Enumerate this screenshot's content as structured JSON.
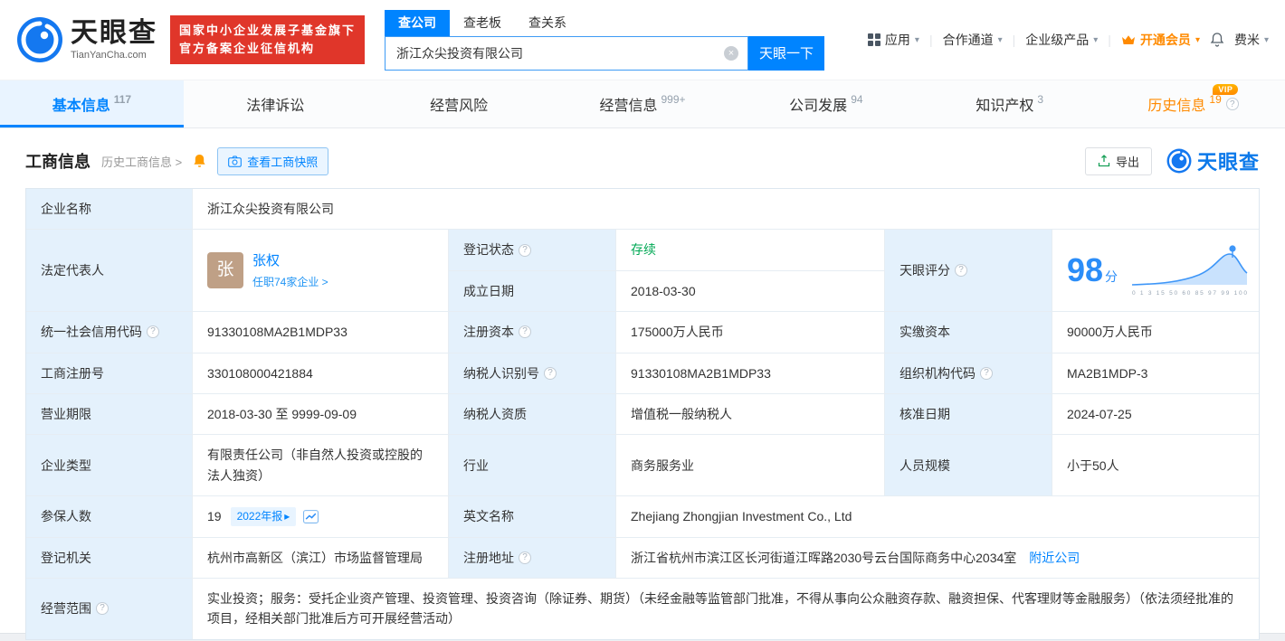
{
  "colors": {
    "primary_blue": "#0084ff",
    "orange": "#ff8a00",
    "green": "#00a854",
    "badge_red": "#e0362a"
  },
  "header": {
    "logo_title": "天眼查",
    "logo_subtitle": "TianYanCha.com",
    "badge_line1": "国家中小企业发展子基金旗下",
    "badge_line2": "官方备案企业征信机构",
    "search_tabs": [
      {
        "label": "查公司"
      },
      {
        "label": "查老板"
      },
      {
        "label": "查关系"
      }
    ],
    "search_value": "浙江众尖投资有限公司",
    "search_button": "天眼一下",
    "nav_app": "应用",
    "nav_coop": "合作通道",
    "nav_product": "企业级产品",
    "nav_vip": "开通会员",
    "nav_user": "费米"
  },
  "tabs": [
    {
      "label": "基本信息",
      "count": "117"
    },
    {
      "label": "法律诉讼",
      "count": ""
    },
    {
      "label": "经营风险",
      "count": ""
    },
    {
      "label": "经营信息",
      "count": "999+"
    },
    {
      "label": "公司发展",
      "count": "94"
    },
    {
      "label": "知识产权",
      "count": "3"
    },
    {
      "label": "历史信息",
      "count": "19",
      "vip": "VIP"
    }
  ],
  "section": {
    "title": "工商信息",
    "history_link": "历史工商信息 >",
    "snapshot_button": "查看工商快照",
    "export_button": "导出",
    "brand": "天眼查"
  },
  "table": {
    "company_name_label": "企业名称",
    "company_name": "浙江众尖投资有限公司",
    "legal_rep_label": "法定代表人",
    "legal_rep_avatar": "张",
    "legal_rep_name": "张权",
    "legal_rep_jobs": "任职74家企业 >",
    "reg_status_label": "登记状态",
    "reg_status": "存续",
    "establish_label": "成立日期",
    "establish_date": "2018-03-30",
    "score_label": "天眼评分",
    "score": "98",
    "score_unit": "分",
    "score_ticks": "0 1 3 15 50 60 85 97 99 100",
    "credit_code_label": "统一社会信用代码",
    "credit_code": "91330108MA2B1MDP33",
    "reg_capital_label": "注册资本",
    "reg_capital": "175000万人民币",
    "paid_capital_label": "实缴资本",
    "paid_capital": "90000万人民币",
    "reg_number_label": "工商注册号",
    "reg_number": "330108000421884",
    "taxpayer_id_label": "纳税人识别号",
    "taxpayer_id": "91330108MA2B1MDP33",
    "org_code_label": "组织机构代码",
    "org_code": "MA2B1MDP-3",
    "term_label": "营业期限",
    "term": "2018-03-30 至 9999-09-09",
    "taxpayer_quality_label": "纳税人资质",
    "taxpayer_quality": "增值税一般纳税人",
    "approve_date_label": "核准日期",
    "approve_date": "2024-07-25",
    "company_type_label": "企业类型",
    "company_type": "有限责任公司（非自然人投资或控股的法人独资）",
    "industry_label": "行业",
    "industry": "商务服务业",
    "staff_label": "人员规模",
    "staff": "小于50人",
    "insured_label": "参保人数",
    "insured": "19",
    "insured_tag": "2022年报",
    "english_name_label": "英文名称",
    "english_name": "Zhejiang Zhongjian Investment Co., Ltd",
    "authority_label": "登记机关",
    "authority": "杭州市高新区（滨江）市场监督管理局",
    "address_label": "注册地址",
    "address": "浙江省杭州市滨江区长河街道江晖路2030号云台国际商务中心2034室",
    "address_link": "附近公司",
    "scope_label": "经营范围",
    "scope": "实业投资；服务：受托企业资产管理、投资管理、投资咨询（除证券、期货）（未经金融等监管部门批准，不得从事向公众融资存款、融资担保、代客理财等金融服务）（依法须经批准的项目，经相关部门批准后方可开展经营活动）"
  }
}
